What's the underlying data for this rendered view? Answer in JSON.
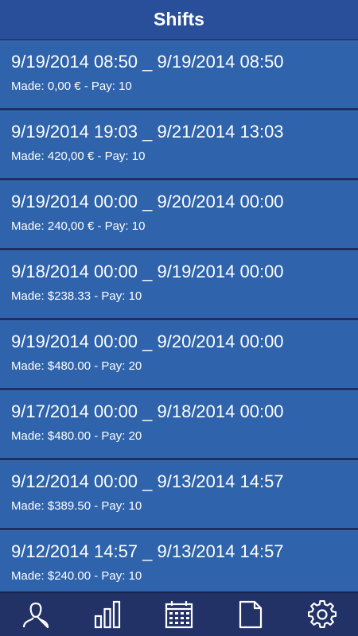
{
  "header": {
    "title": "Shifts"
  },
  "shifts": [
    {
      "range": "9/19/2014 08:50 _ 9/19/2014 08:50",
      "details": "Made: 0,00 € - Pay: 10"
    },
    {
      "range": "9/19/2014 19:03 _ 9/21/2014 13:03",
      "details": "Made: 420,00 € - Pay: 10"
    },
    {
      "range": "9/19/2014 00:00 _ 9/20/2014 00:00",
      "details": "Made: 240,00 € - Pay: 10"
    },
    {
      "range": "9/18/2014 00:00 _ 9/19/2014 00:00",
      "details": "Made: $238.33 - Pay: 10"
    },
    {
      "range": "9/19/2014 00:00 _ 9/20/2014 00:00",
      "details": "Made: $480.00 - Pay: 20"
    },
    {
      "range": "9/17/2014 00:00 _ 9/18/2014 00:00",
      "details": "Made: $480.00 - Pay: 20"
    },
    {
      "range": "9/12/2014 00:00 _ 9/13/2014 14:57",
      "details": "Made: $389.50 - Pay: 10"
    },
    {
      "range": "9/12/2014 14:57 _ 9/13/2014 14:57",
      "details": "Made: $240.00 - Pay: 10"
    }
  ],
  "bottom_nav": {
    "icons": [
      "user-icon",
      "bar-chart-icon",
      "calendar-icon",
      "document-icon",
      "gear-icon"
    ]
  },
  "colors": {
    "header_bg": "#2a4f9a",
    "row_bg": "#2f63ab",
    "bottom_bar_bg": "#223166",
    "text": "#ffffff"
  }
}
